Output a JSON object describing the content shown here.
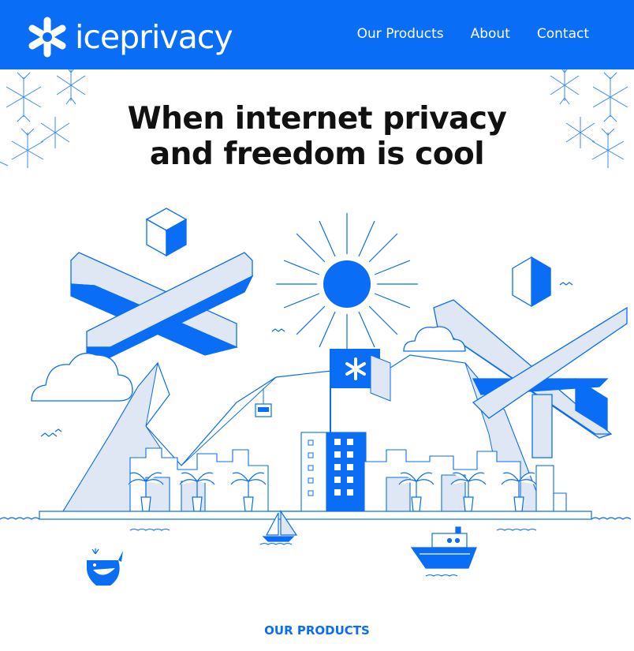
{
  "brand": {
    "name": "iceprivacy",
    "logo_icon": "snowflake-asterisk-icon",
    "primary_color": "#0a6df5"
  },
  "nav": {
    "items": [
      {
        "label": "Our Products"
      },
      {
        "label": "About"
      },
      {
        "label": "Contact"
      }
    ]
  },
  "hero": {
    "title_line1": "When internet privacy",
    "title_line2": "and freedom is cool",
    "illustration": "city-island-with-ice-crystals"
  },
  "sections": {
    "products_label": "OUR PRODUCTS"
  }
}
